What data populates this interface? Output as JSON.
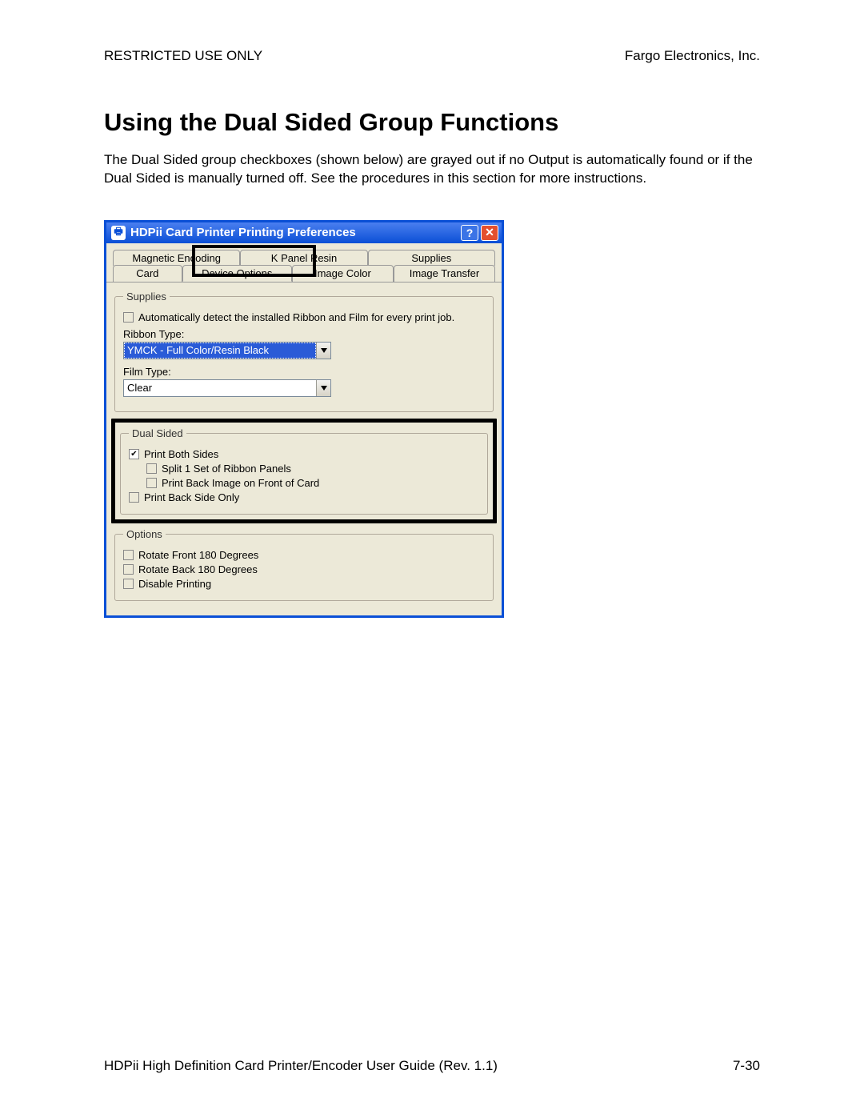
{
  "header": {
    "left": "RESTRICTED USE ONLY",
    "right": "Fargo Electronics, Inc."
  },
  "title": "Using the Dual Sided Group Functions",
  "paragraph": "The Dual Sided group checkboxes (shown below) are grayed out if no Output is automatically found or if the Dual Sided is manually turned off. See the procedures in this section for more instructions.",
  "dialog": {
    "title": "HDPii Card Printer Printing Preferences",
    "tabs_back": [
      "Magnetic Encoding",
      "K Panel Resin",
      "Supplies"
    ],
    "tabs_front": [
      "Card",
      "Device Options",
      "Image Color",
      "Image Transfer"
    ],
    "active_tab": "Device Options",
    "supplies": {
      "legend": "Supplies",
      "auto_detect": "Automatically detect the installed Ribbon and Film for every print job.",
      "ribbon_label": "Ribbon Type:",
      "ribbon_value": "YMCK - Full Color/Resin Black",
      "film_label": "Film Type:",
      "film_value": "Clear"
    },
    "dual": {
      "legend": "Dual Sided",
      "print_both": "Print Both Sides",
      "split": "Split 1 Set of Ribbon Panels",
      "print_back_front": "Print Back Image on Front of Card",
      "back_only": "Print Back Side Only"
    },
    "options": {
      "legend": "Options",
      "rot_front": "Rotate Front 180 Degrees",
      "rot_back": "Rotate Back 180 Degrees",
      "disable": "Disable Printing"
    }
  },
  "footer": {
    "left": "HDPii High Definition Card Printer/Encoder User Guide (Rev. 1.1)",
    "right": "7-30"
  }
}
